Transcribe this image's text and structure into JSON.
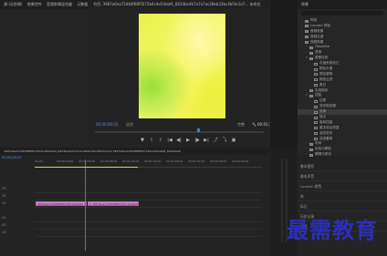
{
  "source_panel": {
    "tabs": [
      "源:(无剪辑)",
      "效果控件",
      "音频剪辑混合器",
      "元数据"
    ]
  },
  "program_monitor": {
    "title": "节目: 3987a6ea72d64f68f5072b4cde54ebf4_6634be4b7a7a7ac28eb33bc4bf3e1a7... 未命名",
    "timecode_left": "00;00;08;03",
    "fit_label": "适合",
    "quality_label": "完整",
    "timecode_right": "00;01;14;29",
    "controls": [
      "▼",
      "I",
      "I",
      "|◀",
      "◀|",
      "▶",
      "|▶",
      "▶|",
      "⤴",
      "⤵",
      "▣"
    ]
  },
  "project_panel": {
    "title": "效果",
    "tree": [
      {
        "label": "预设",
        "indent": 0,
        "type": "folder"
      },
      {
        "label": "Lumetri 预设",
        "indent": 0,
        "type": "folder"
      },
      {
        "label": "音频效果",
        "indent": 0,
        "type": "folder"
      },
      {
        "label": "音频过渡",
        "indent": 0,
        "type": "folder"
      },
      {
        "label": "视频效果",
        "indent": 0,
        "type": "folder"
      },
      {
        "label": "Obsolete",
        "indent": 1,
        "type": "folder"
      },
      {
        "label": "变换",
        "indent": 1,
        "type": "folder"
      },
      {
        "label": "图像控制",
        "indent": 1,
        "type": "folder-open"
      },
      {
        "label": "灰度系数校正",
        "indent": 2,
        "type": "file"
      },
      {
        "label": "颜色平衡",
        "indent": 2,
        "type": "file"
      },
      {
        "label": "颜色替换",
        "indent": 2,
        "type": "file"
      },
      {
        "label": "颜色过滤",
        "indent": 2,
        "type": "file"
      },
      {
        "label": "黑白",
        "indent": 2,
        "type": "file"
      },
      {
        "label": "实用程序",
        "indent": 1,
        "type": "folder"
      },
      {
        "label": "扭曲",
        "indent": 1,
        "type": "folder-open"
      },
      {
        "label": "位移",
        "indent": 2,
        "type": "file"
      },
      {
        "label": "变形稳定器",
        "indent": 2,
        "type": "file"
      },
      {
        "label": "变换",
        "indent": 2,
        "type": "file",
        "selected": true
      },
      {
        "label": "放大",
        "indent": 2,
        "type": "file"
      },
      {
        "label": "旋转扭曲",
        "indent": 2,
        "type": "file"
      },
      {
        "label": "果冻效应修复",
        "indent": 2,
        "type": "file"
      },
      {
        "label": "波形变形",
        "indent": 2,
        "type": "file"
      },
      {
        "label": "湍流置换",
        "indent": 2,
        "type": "file"
      },
      {
        "label": "时间",
        "indent": 1,
        "type": "folder"
      },
      {
        "label": "杂色与颗粒",
        "indent": 1,
        "type": "folder"
      },
      {
        "label": "模糊与锐化",
        "indent": 1,
        "type": "folder"
      }
    ]
  },
  "effects_list": {
    "items": [
      "基本图形",
      "基本声音",
      "Lumetri 颜色",
      "库",
      "标记",
      "历史记录",
      "信息"
    ]
  },
  "timeline": {
    "sequence_title": "3987a6ea72d64f68f5072b4cde54ebf4_6634be4b7a7a7ac28eb33bc4bf3e1a7e  3987a6ea72d64f68f5072b4cde54ebf4_6634be4b",
    "timecode": "00;00;08;03",
    "ticks": [
      "00;00",
      "00;00;16;00",
      "00;00;32;00",
      "00;00;48;00",
      "00;01;04;02",
      "00;01;20;02",
      "00;01;36;02",
      "00;01;52;02",
      "00;02;08;04",
      "00;02;24;04"
    ],
    "tracks": [
      "V3",
      "V2",
      "V1",
      "A1",
      "A2",
      "A3"
    ],
    "clips": [
      {
        "label": "3987a6ea72d64f68f5072b4cde54ebf4_6634be4b...",
        "track": "V1"
      },
      {
        "label": "fx 3987a6ea72d64f68f5072b4cde54ebf4_6634be4b...",
        "track": "V1"
      }
    ]
  },
  "watermark": "最需教育"
}
